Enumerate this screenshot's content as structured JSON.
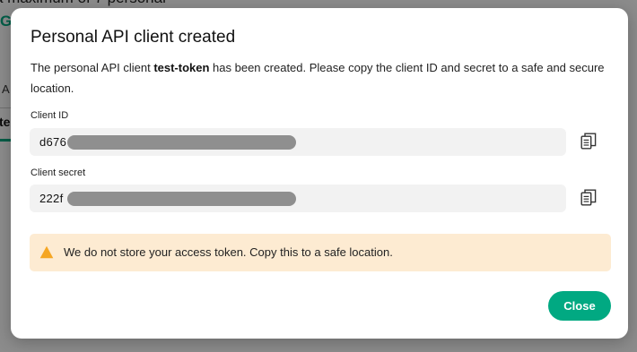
{
  "background": {
    "top_text": "a maximum of 7 personal",
    "partial_heading": "G",
    "partial_label": "A",
    "partial_tab": "te"
  },
  "modal": {
    "title": "Personal API client created",
    "description_before": "The personal API client ",
    "client_name": "test-token",
    "description_after": " has been created. Please copy the client ID and secret to a safe and secure location.",
    "client_id": {
      "label": "Client ID",
      "visible_prefix": "d676",
      "redacted": true
    },
    "client_secret": {
      "label": "Client secret",
      "visible_prefix": "222f",
      "redacted": true
    },
    "copy_icon": "copy-icon",
    "alert": {
      "icon": "warning-icon",
      "text": "We do not store your access token. Copy this to a safe location."
    },
    "close_label": "Close"
  },
  "colors": {
    "accent": "#01a982",
    "warning_bg": "#fdebd2",
    "warning_icon": "#f5a623",
    "field_bg": "#f2f2f2"
  }
}
